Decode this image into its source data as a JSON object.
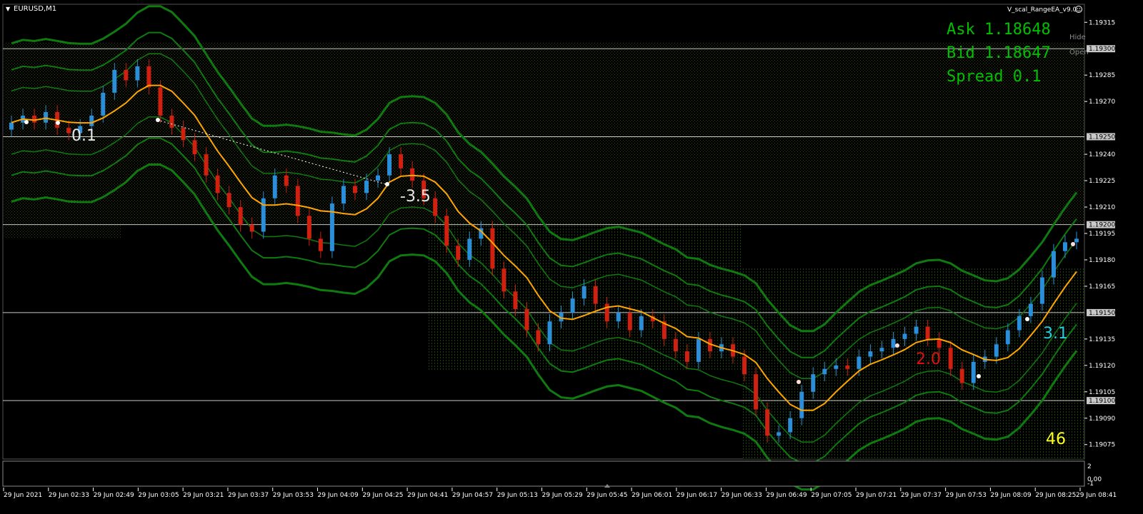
{
  "window": {
    "symbol_label": "EURUSD,M1",
    "ea_label": "V_scal_RangeEA_v9.0",
    "smiley_icon": "smiley-icon",
    "hide_label": "Hide",
    "open_label": "Open"
  },
  "quote_panel": {
    "ask": "Ask 1.18648",
    "bid": "Bid 1.18647",
    "spread": "Spread 0.1",
    "color": "#00c000"
  },
  "annotations": {
    "pips_1": "0.1",
    "pips_2": "-3.5",
    "pips_3": "2.0",
    "pips_4": "3.1",
    "counter": "46"
  },
  "price_axis": {
    "ticks": [
      "1.19315",
      "1.19285",
      "1.19270",
      "1.19240",
      "1.19225",
      "1.19210",
      "1.19195",
      "1.19180",
      "1.19165",
      "1.19135",
      "1.19120",
      "1.19105",
      "1.19090",
      "1.19075"
    ],
    "tick_values": [
      1.19315,
      1.19285,
      1.1927,
      1.1924,
      1.19225,
      1.1921,
      1.19195,
      1.1918,
      1.19165,
      1.19135,
      1.1912,
      1.19105,
      1.1909,
      1.19075
    ],
    "level_boxes": [
      "1.19300",
      "1.19250",
      "1.19200",
      "1.19150",
      "1.19100"
    ],
    "level_values": [
      1.193,
      1.1925,
      1.192,
      1.1915,
      1.191
    ]
  },
  "sub_window": {
    "ticks": [
      "2",
      "0.00",
      "-1"
    ]
  },
  "time_axis": {
    "ticks": [
      "29 Jun 2021",
      "29 Jun 02:33",
      "29 Jun 02:49",
      "29 Jun 03:05",
      "29 Jun 03:21",
      "29 Jun 03:37",
      "29 Jun 03:53",
      "29 Jun 04:09",
      "29 Jun 04:25",
      "29 Jun 04:41",
      "29 Jun 04:57",
      "29 Jun 05:13",
      "29 Jun 05:29",
      "29 Jun 05:45",
      "29 Jun 06:01",
      "29 Jun 06:17",
      "29 Jun 06:33",
      "29 Jun 06:49",
      "29 Jun 07:05",
      "29 Jun 07:21",
      "29 Jun 07:37",
      "29 Jun 07:53",
      "29 Jun 08:09",
      "29 Jun 08:25",
      "29 Jun 08:41"
    ]
  },
  "chart_data": {
    "type": "candlestick",
    "symbol": "EURUSD",
    "timeframe": "M1",
    "ylim": [
      1.19068,
      1.19322
    ],
    "close": [
      1.19258,
      1.19262,
      1.19258,
      1.19264,
      1.19255,
      1.19252,
      1.19256,
      1.19262,
      1.19275,
      1.19288,
      1.19282,
      1.1929,
      1.19278,
      1.19262,
      1.19255,
      1.19248,
      1.1924,
      1.19228,
      1.19218,
      1.1921,
      1.192,
      1.19196,
      1.19215,
      1.19228,
      1.19222,
      1.19205,
      1.19192,
      1.19185,
      1.19212,
      1.19222,
      1.19218,
      1.19225,
      1.19228,
      1.1924,
      1.19232,
      1.19225,
      1.19215,
      1.19205,
      1.19188,
      1.1918,
      1.19192,
      1.19198,
      1.19175,
      1.19162,
      1.19152,
      1.1914,
      1.19132,
      1.19145,
      1.1915,
      1.19158,
      1.19165,
      1.19155,
      1.19145,
      1.1915,
      1.1914,
      1.19148,
      1.19145,
      1.19135,
      1.19128,
      1.19122,
      1.19135,
      1.19128,
      1.19132,
      1.19125,
      1.19115,
      1.19095,
      1.1908,
      1.19082,
      1.1909,
      1.19105,
      1.19115,
      1.19118,
      1.1912,
      1.19118,
      1.19125,
      1.19128,
      1.1913,
      1.19135,
      1.19138,
      1.19142,
      1.19135,
      1.1913,
      1.19118,
      1.1911,
      1.19122,
      1.19125,
      1.19132,
      1.1914,
      1.19148,
      1.19155,
      1.1917,
      1.19185,
      1.1919,
      1.19192
    ],
    "ma_color": "#ffa500",
    "band_color": "#0f7a0f",
    "up_color": "#2a8fd8",
    "down_color": "#d02010",
    "levels": [
      1.193,
      1.1925,
      1.192,
      1.1915,
      1.191
    ]
  }
}
